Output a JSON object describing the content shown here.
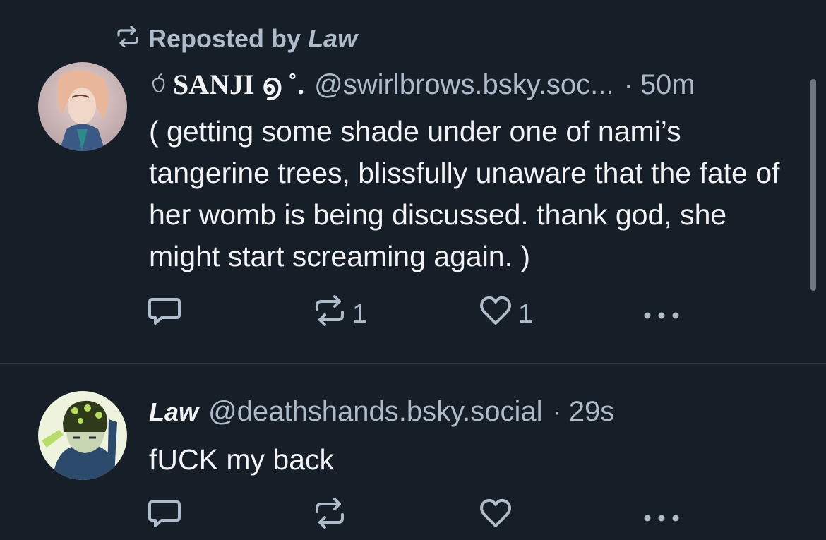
{
  "repost": {
    "prefix": "Reposted by",
    "by": "Law"
  },
  "posts": [
    {
      "display_name_prefix": "　",
      "display_name": "SANJI ൭ ˚.",
      "handle": "@swirlbrows.bsky.soc...",
      "separator": "·",
      "time": "50m",
      "text": "( getting some shade under one of nami’s tangerine trees, blissfully unaware that the fate of her womb is being discussed. thank god, she might start screaming again. )",
      "reposts": "1",
      "likes": "1"
    },
    {
      "display_name": "Law",
      "handle": "@deathshands.bsky.social",
      "separator": "·",
      "time": "29s",
      "text": "fUCK my back",
      "reposts": "",
      "likes": ""
    }
  ],
  "icons": {
    "repost_header": "repost-icon",
    "reply": "reply-icon",
    "repost": "repost-icon",
    "like": "heart-icon",
    "more": "more-icon",
    "name_decoration": "bell-pepper-icon"
  },
  "colors": {
    "background": "#161e27",
    "text": "#f1f3f5",
    "muted": "#aebbc9",
    "divider": "#2c3845"
  }
}
